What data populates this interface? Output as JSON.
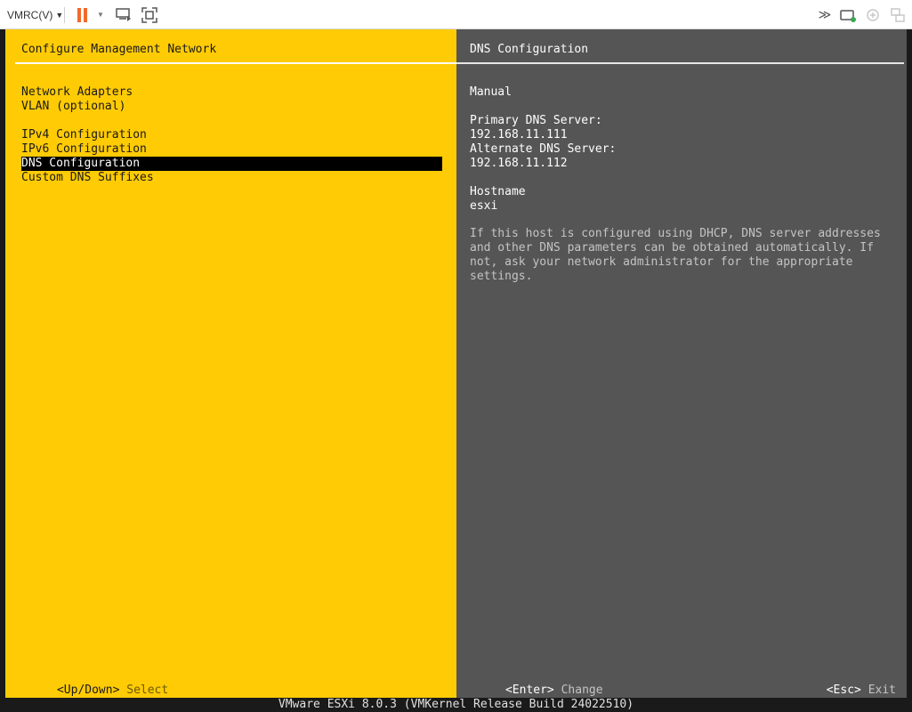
{
  "toolbar": {
    "vmrc_menu_label": "VMRC(V)",
    "icons": [
      "pause-icon",
      "send-ctrl-alt-del-icon",
      "fullscreen-icon",
      "forward-icon",
      "removable-devices-icon",
      "usb-icon",
      "preferences-icon"
    ],
    "accent_color": "#f06a2c"
  },
  "left_panel": {
    "title": "Configure Management Network",
    "items": [
      {
        "label": "Network Adapters",
        "selected": false
      },
      {
        "label": "VLAN (optional)",
        "selected": false
      },
      {
        "label": "IPv4 Configuration",
        "selected": false
      },
      {
        "label": "IPv6 Configuration",
        "selected": false
      },
      {
        "label": "DNS Configuration",
        "selected": true
      },
      {
        "label": "Custom DNS Suffixes",
        "selected": false
      }
    ],
    "footer": {
      "key": "<Up/Down>",
      "action": "Select"
    },
    "background_color": "#ffcb05"
  },
  "right_panel": {
    "title": "DNS Configuration",
    "mode": "Manual",
    "primary_dns_label": "Primary DNS Server:",
    "primary_dns_value": "192.168.11.111",
    "alternate_dns_label": "Alternate DNS Server:",
    "alternate_dns_value": "192.168.11.112",
    "hostname_label": "Hostname",
    "hostname_value": "esxi",
    "help_text": "If this host is configured using DHCP, DNS server addresses\nand other DNS parameters can be obtained automatically. If\nnot, ask your network administrator for the appropriate\nsettings.",
    "footer_enter": {
      "key": "<Enter>",
      "action": "Change"
    },
    "footer_esc": {
      "key": "<Esc>",
      "action": "Exit"
    },
    "background_color": "#555555"
  },
  "status_bar": {
    "text": "VMware ESXi 8.0.3 (VMKernel Release Build 24022510)"
  }
}
